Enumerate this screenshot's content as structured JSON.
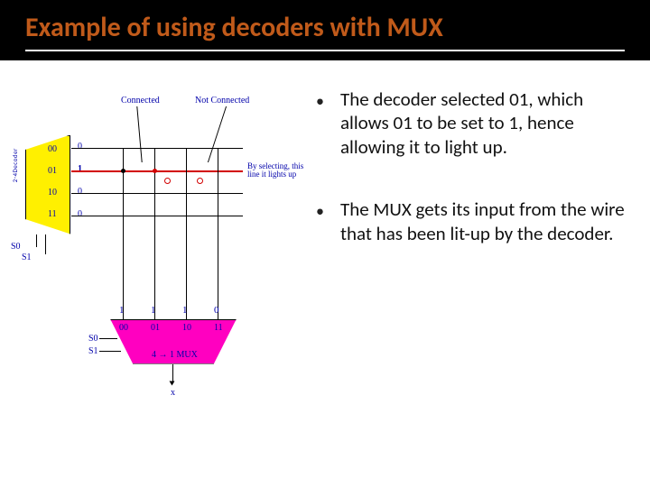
{
  "title": "Example of using decoders with MUX",
  "bullets": [
    "The decoder selected 01, which allows 01 to be set to 1, hence allowing it to light up.",
    "The MUX gets its input from the wire that has been lit-up by the decoder."
  ],
  "diagram": {
    "top_labels": {
      "connected": "Connected",
      "not_connected": "Not Connected"
    },
    "side_note": "By selecting, this line it lights up",
    "decoder": {
      "side_text": "2-4Decoder",
      "inputs": [
        "00",
        "01",
        "10",
        "11"
      ],
      "outputs": [
        "0",
        "1",
        "0",
        "0"
      ],
      "sel_labels": [
        "S0",
        "S1"
      ]
    },
    "mux": {
      "top_values": [
        "1",
        "1",
        "1",
        "0"
      ],
      "inputs": [
        "00",
        "01",
        "10",
        "11"
      ],
      "sel_labels": [
        "S0",
        "S1"
      ],
      "caption": "4 → 1 MUX",
      "output_label": "x"
    }
  }
}
